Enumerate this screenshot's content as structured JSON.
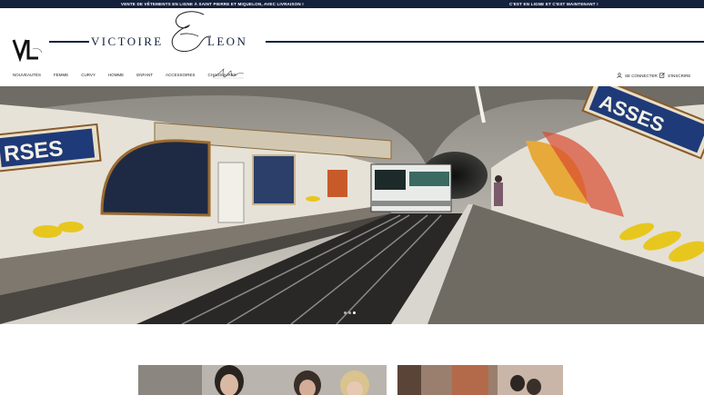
{
  "topbar": {
    "message_left": "VENTE DE VÊTEMENTS EN LIGNE À SAINT PIERRE ET MIQUELON, AVEC LIVRAISON !",
    "message_right": "C'EST EN LIGNE ET C'EST MAINTENANT !"
  },
  "brand": {
    "word_left": "VICTOIRE",
    "word_right": "LEON",
    "logo_mark": "VL",
    "color": "#14213d"
  },
  "nav": {
    "items": [
      "NOUVEAUTÉS",
      "FEMME",
      "CURVY",
      "HOMME",
      "ENFANT",
      "ACCESSOIRES",
      "CHAUSSURES"
    ]
  },
  "account": {
    "login_label": "SE CONNECTER",
    "register_label": "S'INSCRIRE"
  },
  "hero": {
    "slide_count": 3,
    "active_slide": 3
  }
}
